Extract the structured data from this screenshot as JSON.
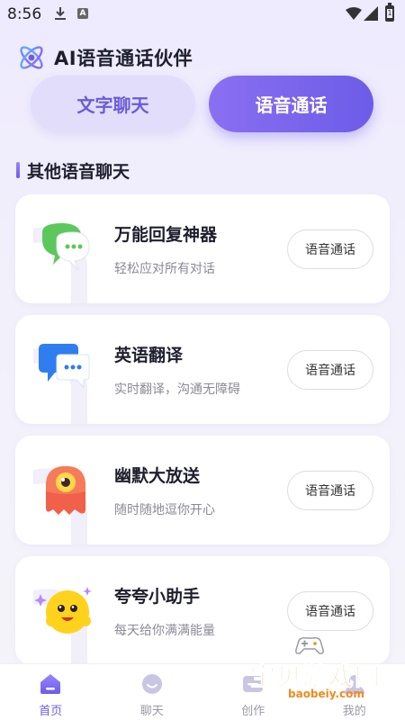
{
  "status_bar": {
    "time": "8:56",
    "battery_text": "1"
  },
  "header": {
    "title": "AI语音通话伙伴",
    "logo_icon": "atom-logo-icon"
  },
  "mode_tabs": {
    "text_chat": "文字聊天",
    "voice_call": "语音通话",
    "active": "voice_call"
  },
  "section": {
    "title": "其他语音聊天"
  },
  "cards": [
    {
      "title": "万能回复神器",
      "subtitle": "轻松应对所有对话",
      "button": "语音通话",
      "icon": "green-chat-bubble-icon"
    },
    {
      "title": "英语翻译",
      "subtitle": "实时翻译，沟通无障碍",
      "button": "语音通话",
      "icon": "blue-chat-bubble-icon"
    },
    {
      "title": "幽默大放送",
      "subtitle": "随时随地逗你开心",
      "button": "语音通话",
      "icon": "red-monster-icon"
    },
    {
      "title": "夸夸小助手",
      "subtitle": "每天给你满满能量",
      "button": "语音通话",
      "icon": "yellow-smiley-icon"
    }
  ],
  "bottom_nav": [
    {
      "label": "首页",
      "icon": "home-icon",
      "active": true
    },
    {
      "label": "聊天",
      "icon": "chat-icon",
      "active": false
    },
    {
      "label": "创作",
      "icon": "create-icon",
      "active": false
    },
    {
      "label": "我的",
      "icon": "profile-icon",
      "active": false
    }
  ],
  "watermark": {
    "main": "宝贝游戏网",
    "sub": "baobeiy.com"
  },
  "colors": {
    "accent": "#6c5ce7",
    "accent_light": "#e2ddfb",
    "watermark": "#f08a1c"
  }
}
